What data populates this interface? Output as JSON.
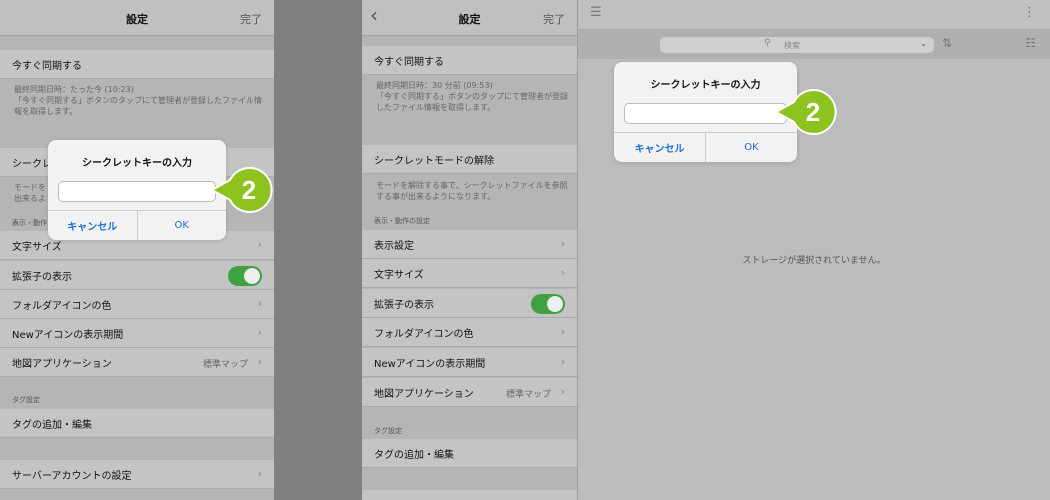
{
  "left": {
    "nav_title": "設定",
    "nav_done": "完了",
    "sync_now": "今すぐ同期する",
    "sync_desc": "最終同期日時：たった今 (10:23)\n「今すぐ同期する」ボタンのタップにて管理者が登録したファイル情報を取得します。",
    "secret_row": "シークレ",
    "secret_desc": "モードを\n出来るよ",
    "section_display": "表示・動作",
    "font_size": "文字サイズ",
    "show_ext": "拡張子の表示",
    "folder_color": "フォルダアイコンの色",
    "new_icon": "Newアイコンの表示期間",
    "map_app": "地図アプリケーション",
    "map_value": "標準マップ",
    "section_tags": "タグ設定",
    "tag_add": "タグの追加・編集",
    "server_account": "サーバーアカウントの設定"
  },
  "mid": {
    "nav_title": "設定",
    "nav_done": "完了",
    "sync_now": "今すぐ同期する",
    "sync_desc": "最終同期日時：30 分前 (09:53)\n「今すぐ同期する」ボタンのタップにて管理者が登録したファイル情報を取得します。",
    "secret_off": "シークレットモードの解除",
    "secret_desc": "モードを解除する事で、シークレットファイルを参照する事が出来るようになります。",
    "section_display": "表示・動作の設定",
    "display_settings": "表示設定",
    "font_size": "文字サイズ",
    "show_ext": "拡張子の表示",
    "folder_color": "フォルダアイコンの色",
    "new_icon": "Newアイコンの表示期間",
    "map_app": "地図アプリケーション",
    "map_value": "標準マップ",
    "section_tags": "タグ設定",
    "tag_add": "タグの追加・編集"
  },
  "right": {
    "search_placeholder": "検索",
    "empty_text": "ストレージが選択されていません。"
  },
  "dialog": {
    "title": "シークレットキーの入力",
    "cancel": "キャンセル",
    "ok": "OK"
  },
  "callout_number": "2",
  "toggle_on": true,
  "colors": {
    "callout": "#8dc21f",
    "toggle": "#3fa142",
    "link": "#1a6fd0"
  }
}
